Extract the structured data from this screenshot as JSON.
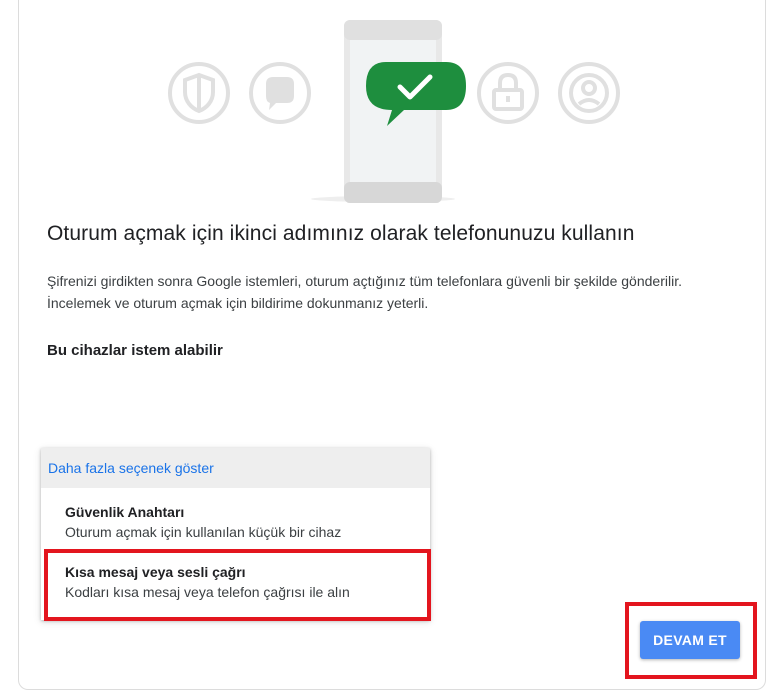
{
  "colors": {
    "accent_blue": "#4a8af4",
    "link_blue": "#1a73e8",
    "check_green": "#1e8e3e",
    "highlight_red": "#e3151e",
    "icon_gray": "#dadce0"
  },
  "icons": [
    "shield-icon",
    "chat-bubble-icon",
    "phone-icon",
    "checkmark-icon",
    "lock-icon",
    "account-icon"
  ],
  "main": {
    "title": "Oturum açmak için ikinci adımınız olarak telefonunuzu kullanın",
    "description": "Şifrenizi girdikten sonra Google istemleri, oturum açtığınız tüm telefonlara güvenli bir şekilde gönderilir. İncelemek ve oturum açmak için bildirime dokunmanız yeterli.",
    "devices_heading": "Bu cihazlar istem alabilir"
  },
  "options_menu": {
    "header_link": "Daha fazla seçenek göster",
    "items": [
      {
        "title": "Güvenlik Anahtarı",
        "subtitle": "Oturum açmak için kullanılan küçük bir cihaz"
      },
      {
        "title": "Kısa mesaj veya sesli çağrı",
        "subtitle": "Kodları kısa mesaj veya telefon çağrısı ile alın"
      }
    ]
  },
  "actions": {
    "continue_label": "DEVAM ET"
  }
}
